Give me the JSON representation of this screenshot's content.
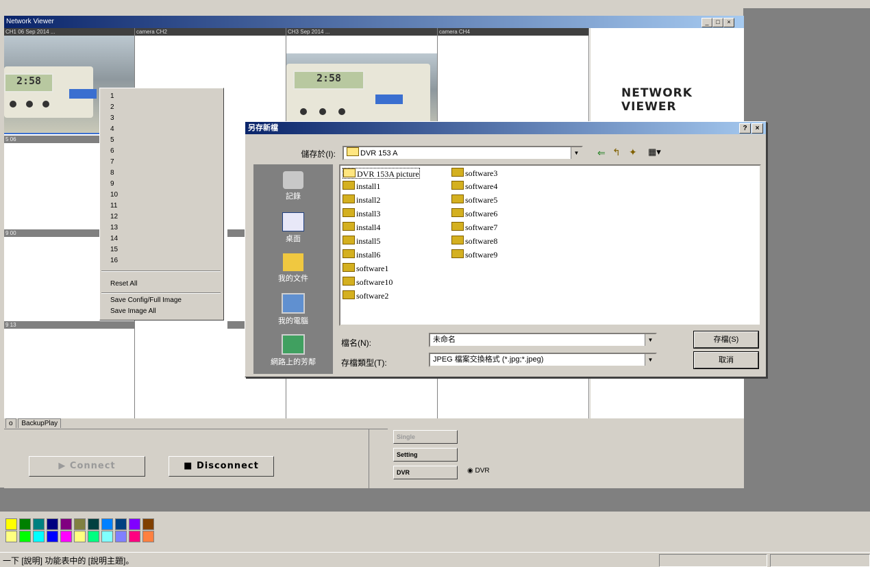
{
  "viewer": {
    "title": "Network Viewer",
    "logo_line1": "NETWORK",
    "logo_line2": "VIEWER",
    "channels": [
      {
        "label": "CH1 06 Sep 2014 ..."
      },
      {
        "label": "camera CH2"
      },
      {
        "label": "CH3 Sep 2014 ..."
      },
      {
        "label": "camera CH4"
      }
    ],
    "row_labels": [
      "5 06",
      "9 00",
      "9 13"
    ]
  },
  "context_menu": {
    "items": [
      "1",
      "2",
      "3",
      "4",
      "5",
      "6",
      "7",
      "8",
      "9",
      "10",
      "11",
      "12",
      "13",
      "14",
      "15",
      "16"
    ],
    "reset_all": "Reset All",
    "save_config": "Save Config/Full Image",
    "save_image_all": "Save Image All"
  },
  "controls": {
    "tab_prev": "o",
    "tab_backup": "BackupPlay",
    "connect": "Connect",
    "disconnect": "Disconnect",
    "single": "Single",
    "setting": "Setting",
    "dvr": "DVR",
    "dvr_label": "DVR"
  },
  "dialog": {
    "title": "另存新檔",
    "save_in_label": "儲存於(I):",
    "save_in_value": "DVR 153 A",
    "places": [
      "記錄",
      "桌面",
      "我的文件",
      "我的電腦",
      "網路上的芳鄰"
    ],
    "files_col1": [
      "DVR 153A picture",
      "install1",
      "install2",
      "install3",
      "install4",
      "install5",
      "install6",
      "software1",
      "software10",
      "software2"
    ],
    "files_col2": [
      "software3",
      "software4",
      "software5",
      "software6",
      "software7",
      "software8",
      "software9"
    ],
    "filename_label": "檔名(N):",
    "filename_value": "未命名",
    "filetype_label": "存檔類型(T):",
    "filetype_value": "JPEG 檔案交換格式 (*.jpg;*.jpeg)",
    "save_button": "存檔(S)",
    "cancel_button": "取消"
  },
  "status": {
    "text": "一下 [說明] 功能表中的 [說明主題]。"
  },
  "palette": [
    "#ffff00",
    "#008000",
    "#008080",
    "#000080",
    "#800080",
    "#808040",
    "#004040",
    "#0080ff",
    "#004080",
    "#8000ff",
    "#804000",
    "#ffff80",
    "#00ff00",
    "#00ffff",
    "#0000ff",
    "#ff00ff",
    "#ffff80",
    "#00ff80",
    "#80ffff",
    "#8080ff",
    "#ff0080",
    "#ff8040"
  ]
}
